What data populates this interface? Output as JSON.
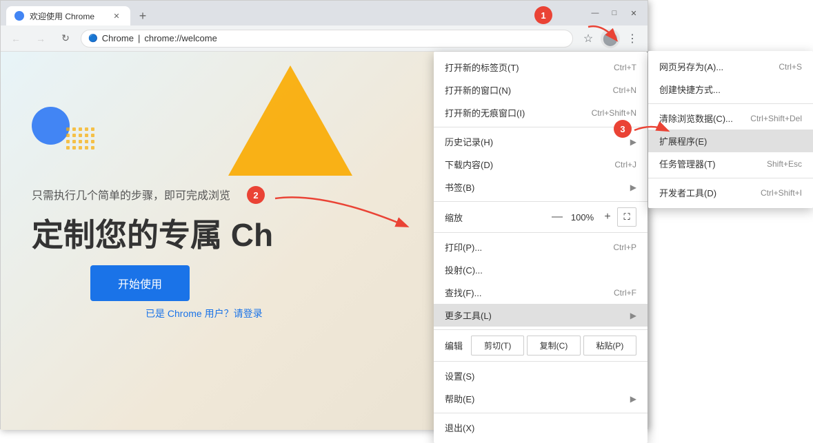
{
  "browser": {
    "tab_title": "欢迎使用 Chrome",
    "tab_favicon_text": "C",
    "new_tab_icon": "+",
    "address": {
      "icon": "🔒",
      "brand": "Chrome",
      "separator": " | ",
      "url": "chrome://welcome"
    },
    "window_controls": {
      "minimize": "—",
      "maximize": "□",
      "close": "✕"
    },
    "toolbar": {
      "bookmark_icon": "☆",
      "account_icon": "●",
      "menu_icon": "⋮"
    }
  },
  "page": {
    "subtitle": "只需执行几个简单的步骤，即可完成浏览",
    "title": "定制您的专属 Ch",
    "start_button": "开始使用",
    "login_link": "已是 Chrome 用户？请登录"
  },
  "step_indicators": {
    "step1": "1",
    "step2": "2",
    "step3": "3"
  },
  "main_menu": {
    "items": [
      {
        "label": "打开新的标签页(T)",
        "shortcut": "Ctrl+T",
        "has_arrow": false
      },
      {
        "label": "打开新的窗口(N)",
        "shortcut": "Ctrl+N",
        "has_arrow": false
      },
      {
        "label": "打开新的无痕窗口(I)",
        "shortcut": "Ctrl+Shift+N",
        "has_arrow": false
      }
    ],
    "divider1": true,
    "history": {
      "label": "历史记录(H)",
      "shortcut": "",
      "has_arrow": true
    },
    "downloads": {
      "label": "下载内容(D)",
      "shortcut": "Ctrl+J",
      "has_arrow": false
    },
    "bookmarks": {
      "label": "书签(B)",
      "shortcut": "",
      "has_arrow": true
    },
    "divider2": true,
    "zoom": {
      "label": "缩放",
      "minus": "—",
      "value": "100%",
      "plus": "+",
      "expand": "⛶"
    },
    "divider3": true,
    "print": {
      "label": "打印(P)...",
      "shortcut": "Ctrl+P",
      "has_arrow": false
    },
    "cast": {
      "label": "投射(C)...",
      "shortcut": "",
      "has_arrow": false
    },
    "find": {
      "label": "查找(F)...",
      "shortcut": "Ctrl+F",
      "has_arrow": false
    },
    "more_tools": {
      "label": "更多工具(L)",
      "shortcut": "",
      "has_arrow": true,
      "highlighted": true
    },
    "divider4": true,
    "edit": {
      "label": "编辑",
      "cut": "剪切(T)",
      "copy": "复制(C)",
      "paste": "粘贴(P)"
    },
    "divider5": true,
    "settings": {
      "label": "设置(S)",
      "shortcut": "",
      "has_arrow": false
    },
    "help": {
      "label": "帮助(E)",
      "shortcut": "",
      "has_arrow": true
    },
    "divider6": true,
    "exit": {
      "label": "退出(X)",
      "shortcut": "",
      "has_arrow": false
    }
  },
  "submenu": {
    "items": [
      {
        "label": "网页另存为(A)...",
        "shortcut": "Ctrl+S"
      },
      {
        "label": "创建快捷方式...",
        "shortcut": ""
      },
      {
        "divider": true
      },
      {
        "label": "清除浏览数据(C)...",
        "shortcut": "Ctrl+Shift+Del",
        "highlighted": false
      },
      {
        "label": "扩展程序(E)",
        "shortcut": "",
        "highlighted": true
      },
      {
        "label": "任务管理器(T)",
        "shortcut": "Shift+Esc"
      },
      {
        "divider2": true
      },
      {
        "label": "开发者工具(D)",
        "shortcut": "Ctrl+Shift+I"
      }
    ]
  }
}
